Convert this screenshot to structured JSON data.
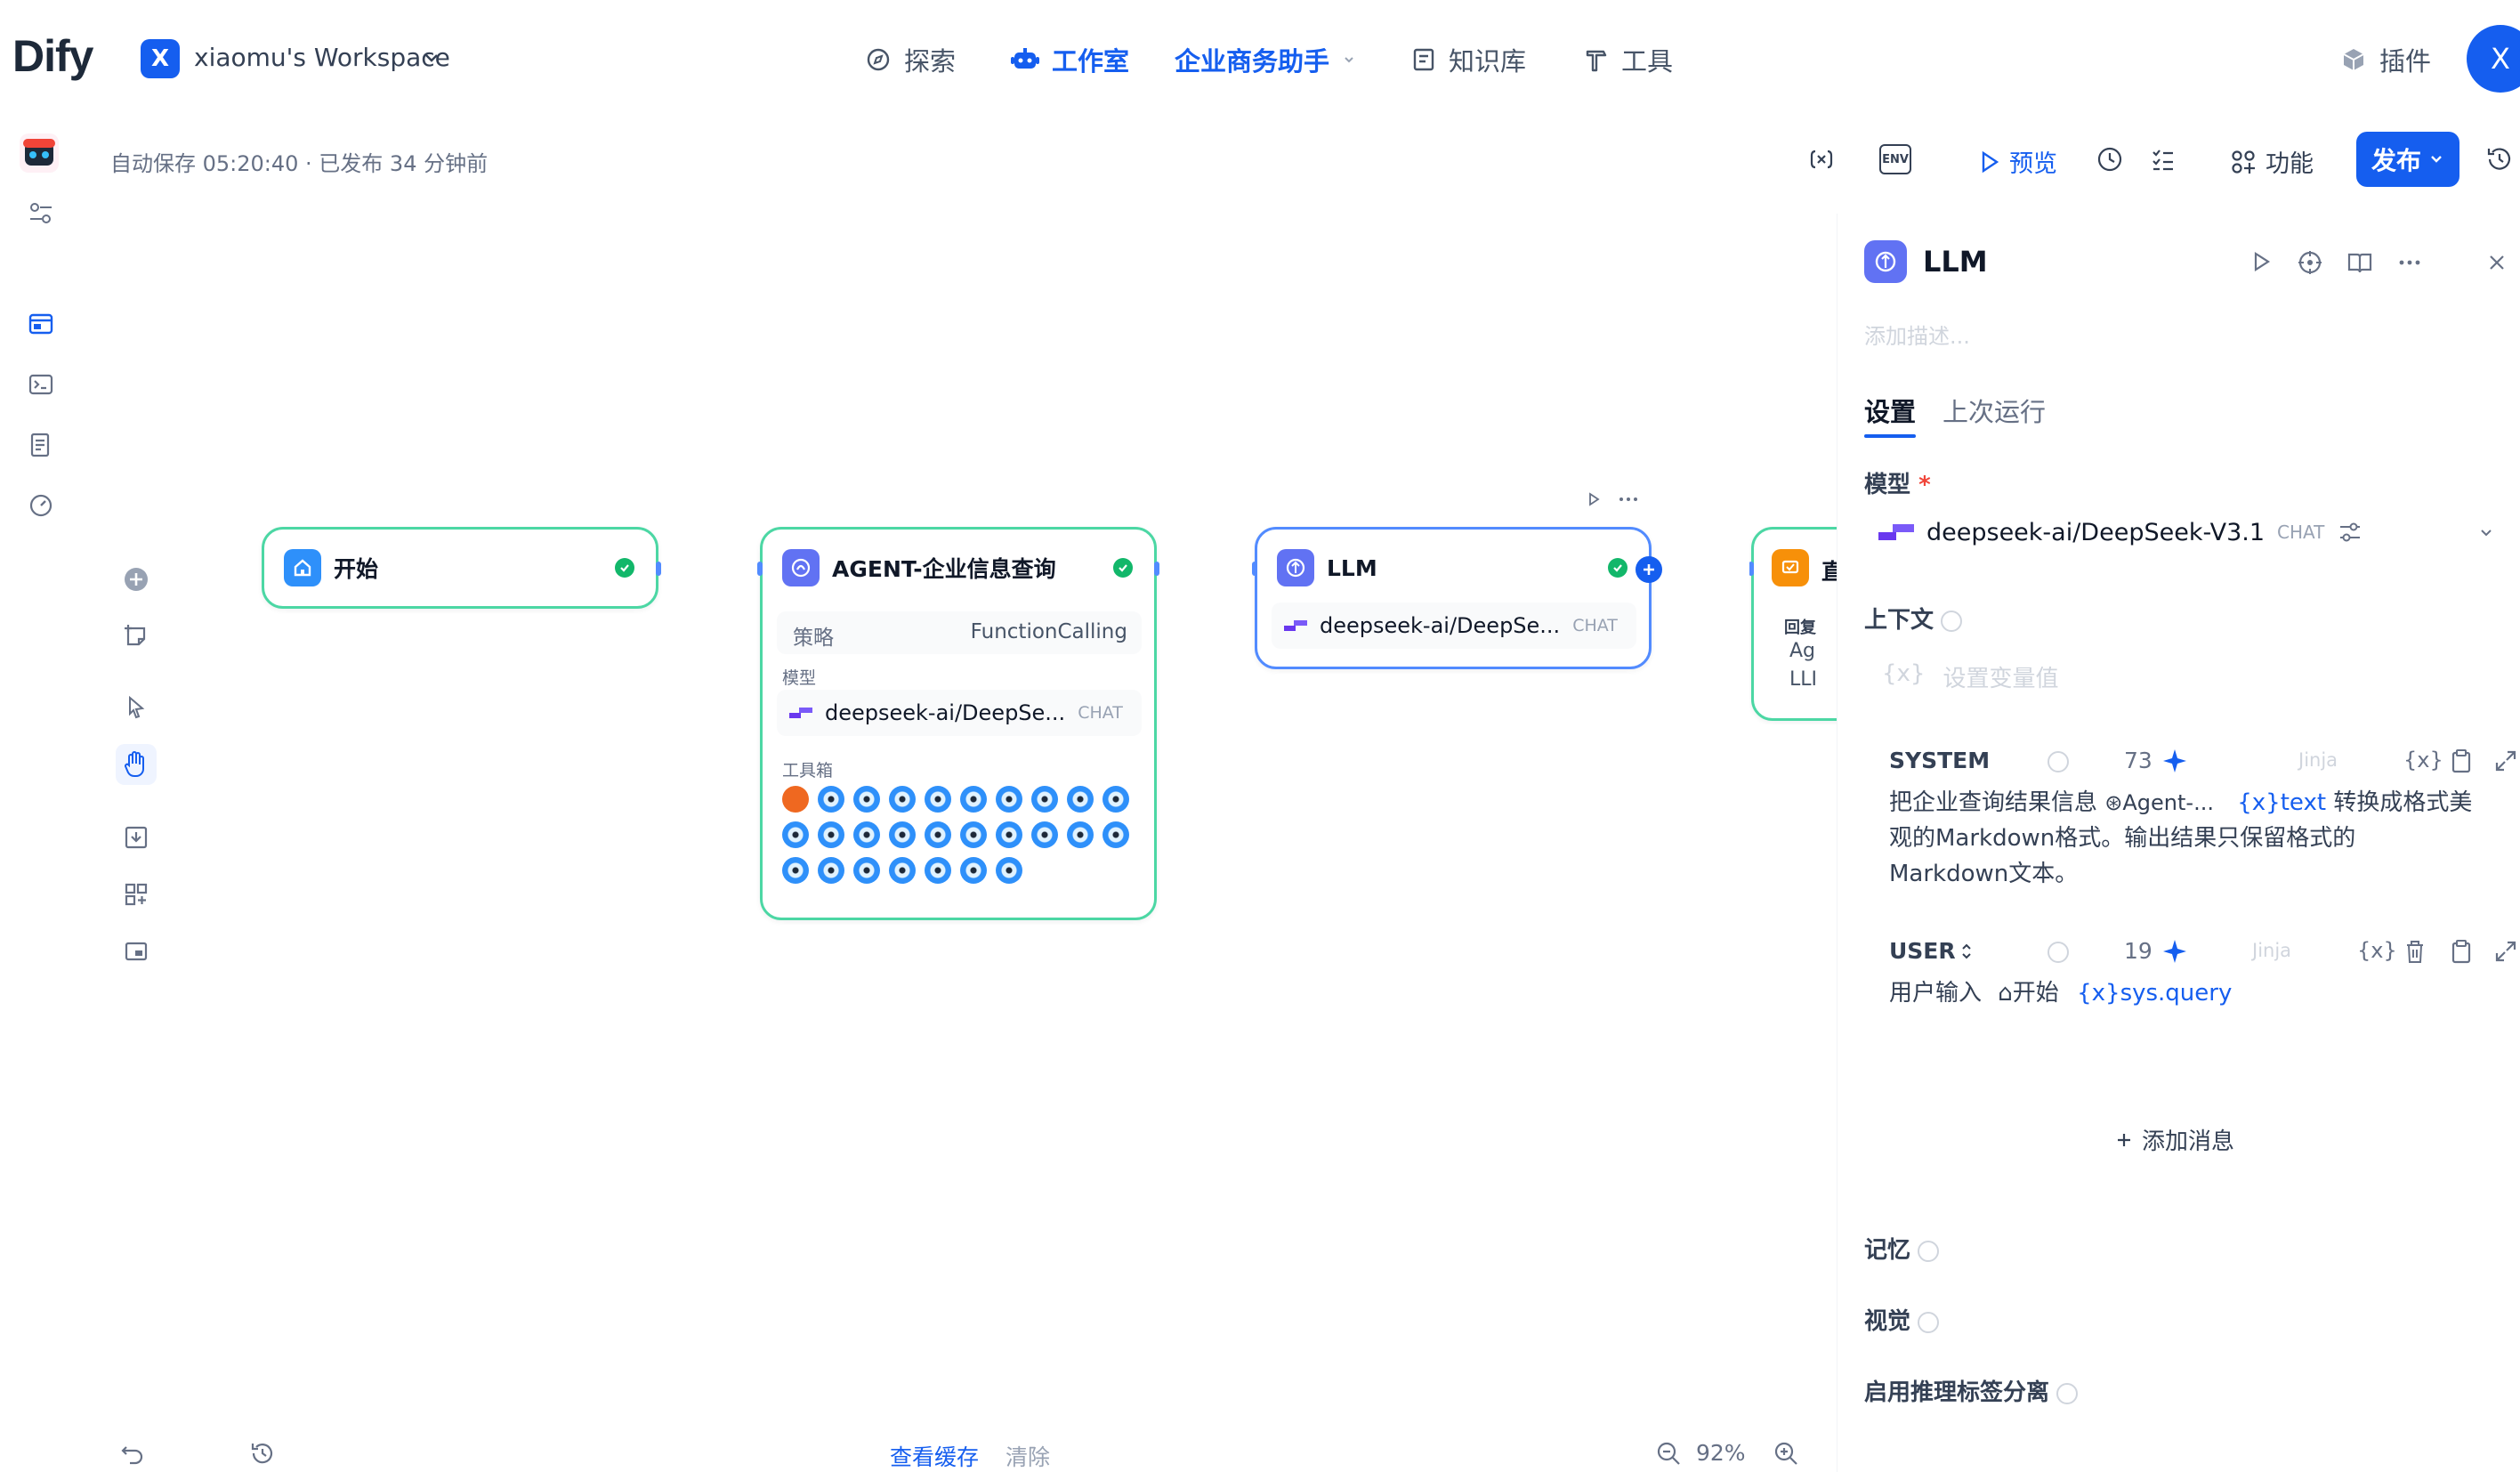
{
  "app": {
    "logo": "Dify",
    "workspace_initial": "X",
    "workspace_name": "xiaomu's Workspace",
    "user_initial": "X"
  },
  "nav": {
    "explore": "探索",
    "studio": "工作室",
    "app_name": "企业商务助手",
    "knowledge": "知识库",
    "tools": "工具",
    "plugins": "插件"
  },
  "status": {
    "autosave": "自动保存 05:20:40 · 已发布 34 分钟前"
  },
  "header_actions": {
    "env": "ENV",
    "preview": "预览",
    "features": "功能",
    "publish": "发布"
  },
  "nodes": {
    "start": {
      "title": "开始"
    },
    "agent": {
      "title": "AGENT-企业信息查询",
      "strategy_label": "策略",
      "strategy_value": "FunctionCalling",
      "model_label": "模型",
      "model_name": "deepseek-ai/DeepSe...",
      "model_tag": "CHAT",
      "toolbox_label": "工具箱",
      "tool_count": 27
    },
    "llm": {
      "title": "LLM",
      "model_name": "deepseek-ai/DeepSe...",
      "model_tag": "CHAT"
    },
    "answer": {
      "title": "直",
      "reply_label": "回复",
      "line1": "Ag",
      "line2": "LLI"
    }
  },
  "panel": {
    "title": "LLM",
    "desc_placeholder": "添加描述...",
    "tab_settings": "设置",
    "tab_last_run": "上次运行",
    "model_label": "模型",
    "required_mark": "*",
    "model_name": "deepseek-ai/DeepSeek-V3.1",
    "model_tag": "CHAT",
    "context_label": "上下文",
    "context_placeholder": "设置变量值",
    "system": {
      "role": "SYSTEM",
      "count": "73",
      "jinja": "Jinja",
      "text_before": "把企业查询结果信息",
      "node_ref": "Agent-...",
      "var_ref": "text",
      "text_after": "转换成格式美",
      "line2": "观的Markdown格式。输出结果只保留格式的",
      "line3": "Markdown文本。"
    },
    "user": {
      "role": "USER",
      "count": "19",
      "jinja": "Jinja",
      "text_before": "用户输入",
      "node_ref": "开始",
      "var_ref": "sys.query"
    },
    "add_message": "添加消息",
    "memory_label": "记忆",
    "vision_label": "视觉",
    "reasoning_label": "启用推理标签分离"
  },
  "footer": {
    "view_cache": "查看缓存",
    "clear": "清除",
    "zoom": "92%"
  },
  "colors": {
    "primary": "#155eef",
    "success": "#12b76a",
    "node_green_border": "#4cd7a4",
    "node_blue_border": "#528bff",
    "agent_icon": "#6172f3",
    "answer_icon": "#f79009"
  }
}
